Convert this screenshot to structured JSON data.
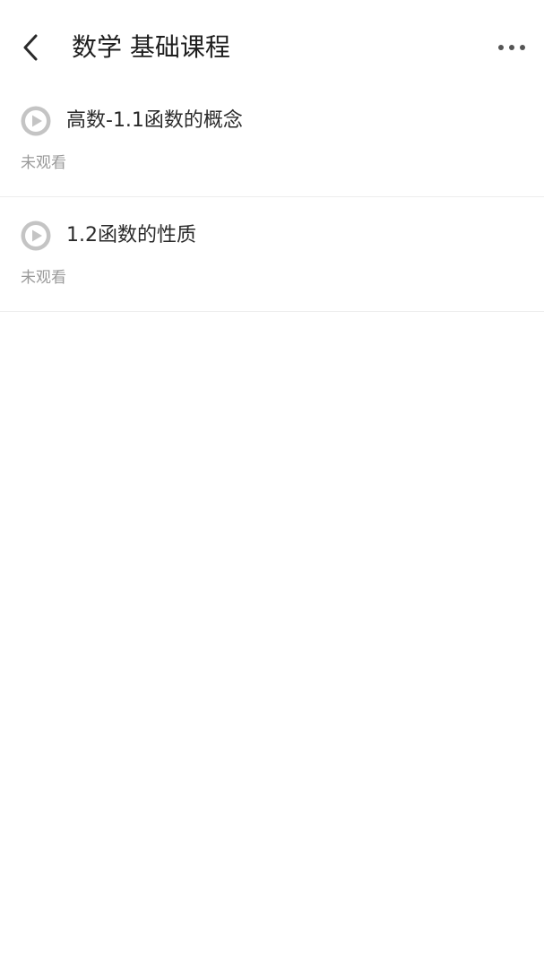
{
  "header": {
    "title": "数学 基础课程"
  },
  "lessons": [
    {
      "title": "高数-1.1函数的概念",
      "status": "未观看"
    },
    {
      "title": "1.2函数的性质",
      "status": "未观看"
    }
  ],
  "icons": {
    "back": "chevron-left-icon",
    "more": "more-horizontal-icon",
    "play": "play-circle-icon"
  },
  "colors": {
    "play_icon": "#c4c4c4",
    "status_text": "#9a9a9a",
    "divider": "#ededed"
  }
}
